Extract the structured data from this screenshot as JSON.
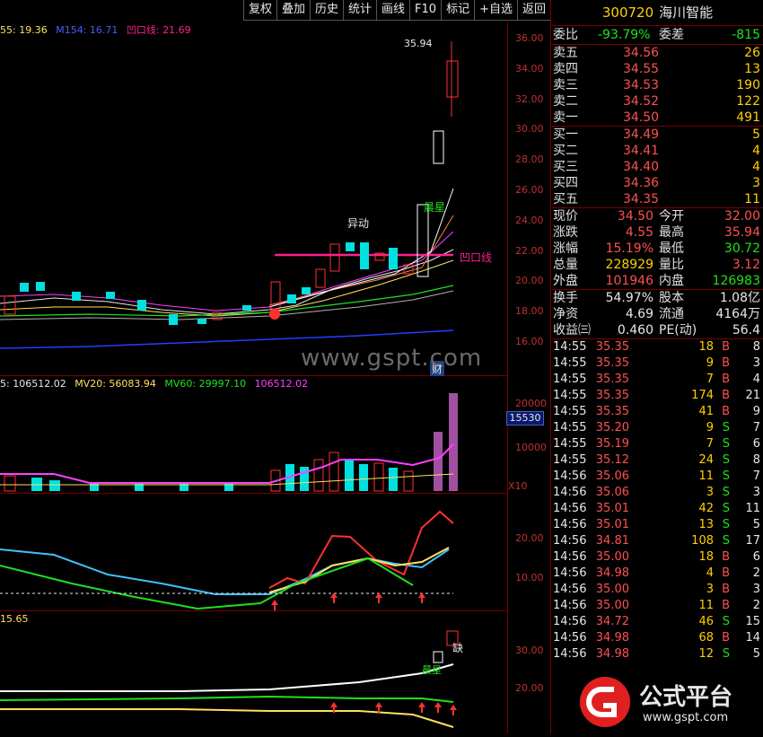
{
  "toolbar": [
    "复权",
    "叠加",
    "历史",
    "统计",
    "画线",
    "F10",
    "标记",
    "+自选",
    "返回"
  ],
  "main_chart": {
    "indicator_ma": "55: 19.36",
    "indicator_m154": "M154: 16.71",
    "indicator_ao": "凹口线: 21.69",
    "high_label": "35.94",
    "annotation_yidong": "异动",
    "annotation_chenxing": "晨星",
    "annotation_aokouxian": "凹口线",
    "annotation_cai": "财",
    "y_ticks": [
      "36.00",
      "34.00",
      "32.00",
      "30.00",
      "28.00",
      "26.00",
      "24.00",
      "22.00",
      "20.00",
      "18.00",
      "16.00"
    ],
    "colors": {
      "up": "#ff3030",
      "down": "#00e0e0",
      "ao": "#ff2090",
      "m154": "#2040ff"
    }
  },
  "volume_chart": {
    "indicator_vol": "5: 106512.02",
    "indicator_mv20": "MV20: 56083.94",
    "indicator_mv60": "MV60: 29997.10",
    "indicator_last": "106512.02",
    "y_ticks": [
      "20000",
      "10000"
    ],
    "current": "15530",
    "unit": "X10"
  },
  "macd_chart": {
    "y_ticks": [
      "20.00",
      "10.00"
    ]
  },
  "fourth_chart": {
    "indicator": "15.65",
    "y_ticks": [
      "30.00",
      "20.00"
    ],
    "annotation_que": "缺",
    "annotation_chenxing": "晨星"
  },
  "watermark": "www.gspt.com",
  "quote": {
    "code": "300720",
    "name": "海川智能",
    "weibi_label": "委比",
    "weibi": "-93.79%",
    "weicha_label": "委差",
    "weicha": "-815",
    "sell": [
      {
        "label": "卖五",
        "price": "34.56",
        "vol": "26"
      },
      {
        "label": "卖四",
        "price": "34.55",
        "vol": "13"
      },
      {
        "label": "卖三",
        "price": "34.53",
        "vol": "190"
      },
      {
        "label": "卖二",
        "price": "34.52",
        "vol": "122"
      },
      {
        "label": "卖一",
        "price": "34.50",
        "vol": "491"
      }
    ],
    "buy": [
      {
        "label": "买一",
        "price": "34.49",
        "vol": "5"
      },
      {
        "label": "买二",
        "price": "34.41",
        "vol": "4"
      },
      {
        "label": "买三",
        "price": "34.40",
        "vol": "4"
      },
      {
        "label": "买四",
        "price": "34.36",
        "vol": "3"
      },
      {
        "label": "买五",
        "price": "34.35",
        "vol": "11"
      }
    ],
    "stats": [
      {
        "l1": "现价",
        "v1": "34.50",
        "l2": "今开",
        "v2": "32.00"
      },
      {
        "l1": "涨跌",
        "v1": "4.55",
        "l2": "最高",
        "v2": "35.94"
      },
      {
        "l1": "涨幅",
        "v1": "15.19%",
        "l2": "最低",
        "v2": "30.72"
      },
      {
        "l1": "总量",
        "v1": "228929",
        "l2": "量比",
        "v2": "3.12"
      },
      {
        "l1": "外盘",
        "v1": "101946",
        "l2": "内盘",
        "v2": "126983"
      }
    ],
    "stats2": [
      {
        "l1": "换手",
        "v1": "54.97%",
        "l2": "股本",
        "v2": "1.08亿"
      },
      {
        "l1": "净资",
        "v1": "4.69",
        "l2": "流通",
        "v2": "4164万"
      },
      {
        "l1": "收益㈢",
        "v1": "0.460",
        "l2": "PE(动)",
        "v2": "56.4"
      }
    ],
    "ticks": [
      {
        "t": "14:55",
        "p": "35.35",
        "v": "18",
        "d": "B",
        "n": "8"
      },
      {
        "t": "14:55",
        "p": "35.35",
        "v": "9",
        "d": "B",
        "n": "3"
      },
      {
        "t": "14:55",
        "p": "35.35",
        "v": "7",
        "d": "B",
        "n": "4"
      },
      {
        "t": "14:55",
        "p": "35.35",
        "v": "174",
        "d": "B",
        "n": "21"
      },
      {
        "t": "14:55",
        "p": "35.35",
        "v": "41",
        "d": "B",
        "n": "9"
      },
      {
        "t": "14:55",
        "p": "35.20",
        "v": "9",
        "d": "S",
        "n": "7"
      },
      {
        "t": "14:55",
        "p": "35.19",
        "v": "7",
        "d": "S",
        "n": "6"
      },
      {
        "t": "14:55",
        "p": "35.12",
        "v": "24",
        "d": "S",
        "n": "8"
      },
      {
        "t": "14:56",
        "p": "35.06",
        "v": "11",
        "d": "S",
        "n": "7"
      },
      {
        "t": "14:56",
        "p": "35.06",
        "v": "3",
        "d": "S",
        "n": "3"
      },
      {
        "t": "14:56",
        "p": "35.01",
        "v": "42",
        "d": "S",
        "n": "11"
      },
      {
        "t": "14:56",
        "p": "35.01",
        "v": "13",
        "d": "S",
        "n": "5"
      },
      {
        "t": "14:56",
        "p": "34.81",
        "v": "108",
        "d": "S",
        "n": "17"
      },
      {
        "t": "14:56",
        "p": "35.00",
        "v": "18",
        "d": "B",
        "n": "6"
      },
      {
        "t": "14:56",
        "p": "34.98",
        "v": "4",
        "d": "B",
        "n": "2"
      },
      {
        "t": "14:56",
        "p": "35.00",
        "v": "3",
        "d": "B",
        "n": "3"
      },
      {
        "t": "14:56",
        "p": "35.00",
        "v": "11",
        "d": "B",
        "n": "2"
      },
      {
        "t": "14:56",
        "p": "34.72",
        "v": "46",
        "d": "S",
        "n": "15"
      },
      {
        "t": "14:56",
        "p": "34.98",
        "v": "68",
        "d": "B",
        "n": "14"
      },
      {
        "t": "14:56",
        "p": "34.98",
        "v": "12",
        "d": "S",
        "n": "5"
      }
    ]
  },
  "logo": {
    "text": "公式平台",
    "url": "www.gspt.com"
  }
}
